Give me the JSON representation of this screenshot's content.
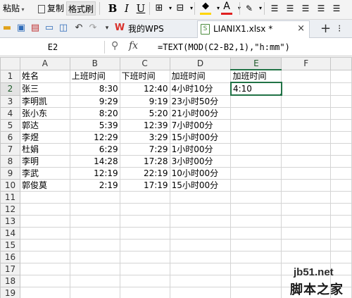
{
  "ribbon": {
    "paste": "粘贴",
    "copy": "复制",
    "format_painter": "格式刷",
    "bold": "B",
    "italic": "I",
    "underline": "U"
  },
  "tabs": {
    "wps_label": "我的WPS",
    "doc_label": "LIANIX1.xlsx *",
    "doc_icon_text": "S",
    "add": "+",
    "more": "⁝"
  },
  "formula_bar": {
    "cell_ref": "E2",
    "fx": "fx",
    "formula": "=TEXT(MOD(C2-B2,1),\"h:mm\")"
  },
  "columns": [
    "A",
    "B",
    "C",
    "D",
    "E",
    "F"
  ],
  "rows": [
    [
      "姓名",
      "上班时间",
      "下班时间",
      "加班时间",
      "加班时间",
      ""
    ],
    [
      "张三",
      "8:30",
      "12:40",
      "4小时10分",
      "4:10",
      ""
    ],
    [
      "李明凯",
      "9:29",
      "9:19",
      "23小时50分",
      "",
      ""
    ],
    [
      "张小东",
      "8:20",
      "5:20",
      "21小时00分",
      "",
      ""
    ],
    [
      "郭达",
      "5:39",
      "12:39",
      "7小时00分",
      "",
      ""
    ],
    [
      "李煜",
      "12:29",
      "3:29",
      "15小时00分",
      "",
      ""
    ],
    [
      "杜娟",
      "6:29",
      "7:29",
      "1小时00分",
      "",
      ""
    ],
    [
      "李明",
      "14:28",
      "17:28",
      "3小时00分",
      "",
      ""
    ],
    [
      "李武",
      "12:19",
      "22:19",
      "10小时00分",
      "",
      ""
    ],
    [
      "郭俊莫",
      "2:19",
      "17:19",
      "15小时00分",
      "",
      ""
    ],
    [
      "",
      "",
      "",
      "",
      "",
      ""
    ],
    [
      "",
      "",
      "",
      "",
      "",
      ""
    ],
    [
      "",
      "",
      "",
      "",
      "",
      ""
    ],
    [
      "",
      "",
      "",
      "",
      "",
      ""
    ],
    [
      "",
      "",
      "",
      "",
      "",
      ""
    ],
    [
      "",
      "",
      "",
      "",
      "",
      ""
    ],
    [
      "",
      "",
      "",
      "",
      "",
      ""
    ],
    [
      "",
      "",
      "",
      "",
      "",
      ""
    ],
    [
      "",
      "",
      "",
      "",
      "",
      ""
    ]
  ],
  "row_numbers": [
    "1",
    "2",
    "3",
    "4",
    "5",
    "6",
    "7",
    "8",
    "9",
    "10",
    "11",
    "12",
    "13",
    "14",
    "15",
    "16",
    "17",
    "18",
    "19"
  ],
  "selected": {
    "column": "E",
    "row": "2"
  },
  "watermark": {
    "url": "jb51.net",
    "brand": "脚本之家"
  },
  "colors": {
    "accent": "#217346",
    "wps_red": "#d9312b",
    "font_red": "#e02020",
    "highlight_yellow": "#ffd500"
  }
}
